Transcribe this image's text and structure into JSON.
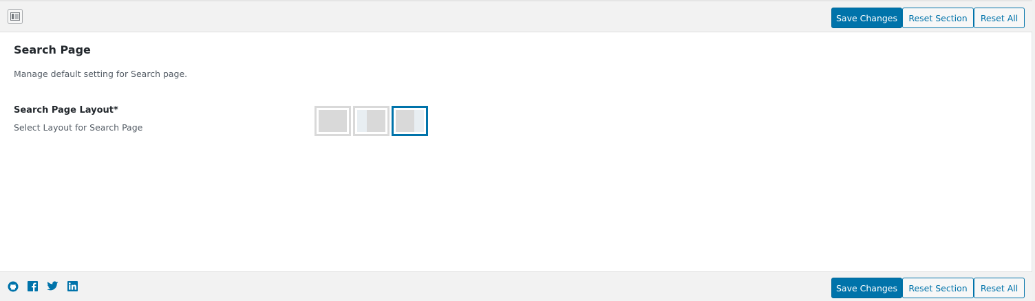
{
  "toolbar": {
    "save_label": "Save Changes",
    "reset_section_label": "Reset Section",
    "reset_all_label": "Reset All",
    "expand_icon": "panel-toggle-icon"
  },
  "section": {
    "title": "Search Page",
    "description": "Manage default setting for Search page."
  },
  "field": {
    "label": "Search Page Layout*",
    "sublabel": "Select Layout for Search Page",
    "options": [
      "no-sidebar",
      "left-sidebar",
      "right-sidebar"
    ],
    "selected": "right-sidebar"
  },
  "footer": {
    "social_icons": [
      "github-icon",
      "facebook-icon",
      "twitter-icon",
      "linkedin-icon"
    ],
    "save_label": "Save Changes",
    "reset_section_label": "Reset Section",
    "reset_all_label": "Reset All"
  },
  "colors": {
    "accent": "#0073aa",
    "bar_bg": "#f2f2f2",
    "text": "#23282d",
    "muted": "#555d66"
  }
}
